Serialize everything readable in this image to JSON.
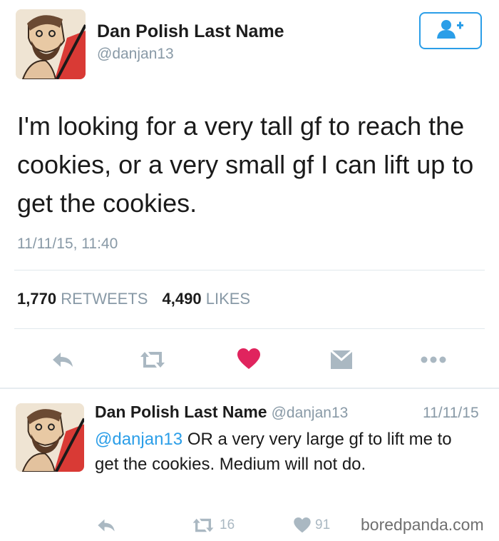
{
  "tweet": {
    "author_name": "Dan Polish Last Name",
    "author_handle": "@danjan13",
    "text": "I'm looking for a very tall gf to reach the cookies, or a very small gf I can lift up to get the cookies.",
    "timestamp": "11/11/15, 11:40",
    "retweets_count": "1,770",
    "retweets_label": "RETWEETS",
    "likes_count": "4,490",
    "likes_label": "LIKES",
    "follow_icon": "add-user-icon",
    "actions": [
      "reply-icon",
      "retweet-icon",
      "heart-icon",
      "message-icon",
      "more-icon"
    ],
    "colors": {
      "accent": "#2b9ee8",
      "like": "#e0245e",
      "icon": "#aab8c2",
      "muted": "#8899a6"
    }
  },
  "reply": {
    "author_name": "Dan Polish Last Name",
    "author_handle": "@danjan13",
    "date": "11/11/15",
    "mention": "@danjan13",
    "text": "OR a very very large gf to lift me to get the cookies. Medium will not do.",
    "retweets_count": "16",
    "likes_count": "91"
  },
  "watermark": "boredpanda.com"
}
